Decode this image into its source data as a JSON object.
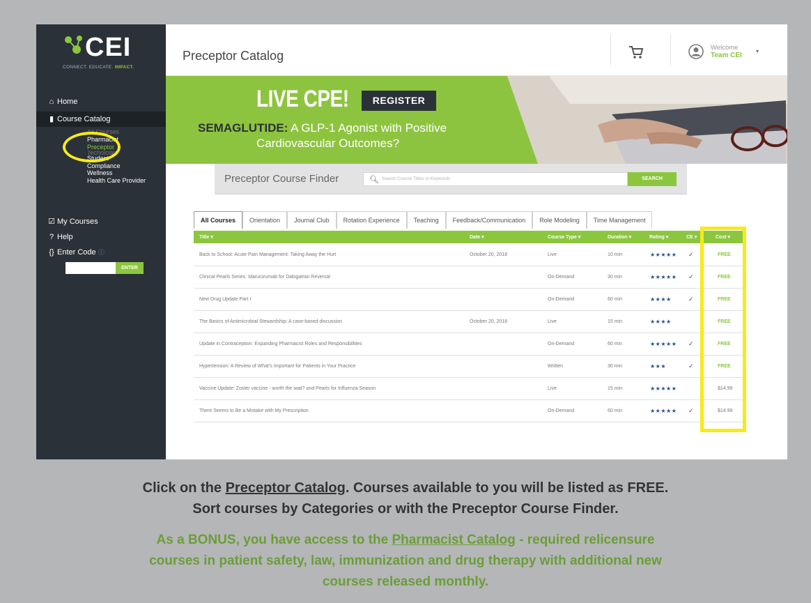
{
  "brand": {
    "logo_text": "CEI",
    "tagline_a": "CONNECT. EDUCATE.",
    "tagline_b": "IMPACT."
  },
  "colors": {
    "accent_green": "#8cc63f",
    "sidebar_dark": "#2b3138",
    "highlight_yellow": "#f6eb16",
    "star_blue": "#2a4e8c"
  },
  "header": {
    "title": "Preceptor Catalog",
    "cart_icon": "cart-icon",
    "welcome_label": "Welcome",
    "user_name": "Team CEI"
  },
  "sidebar": {
    "items": [
      {
        "icon": "home-icon",
        "glyph": "🏠",
        "label": "Home"
      },
      {
        "icon": "book-icon",
        "glyph": "▮",
        "label": "Course Catalog"
      },
      {
        "icon": "check-square-icon",
        "glyph": "☑",
        "label": "My Courses"
      },
      {
        "icon": "question-icon",
        "glyph": "❓",
        "label": "Help"
      },
      {
        "icon": "braces-icon",
        "glyph": "{ }",
        "label": "Enter Code",
        "info": "ⓘ"
      }
    ],
    "subitems": [
      {
        "label": "Pharmacist"
      },
      {
        "label": "Preceptor"
      },
      {
        "label": "Student"
      },
      {
        "label": "Compliance"
      },
      {
        "label": "Wellness"
      },
      {
        "label": "Health Care Provider"
      }
    ],
    "enter_button": "ENTER"
  },
  "banner": {
    "headline": "LIVE CPE!",
    "register_button": "REGISTER",
    "subject_bold": "SEMAGLUTIDE:",
    "subject_line1": " A GLP-1 Agonist with Positive",
    "subject_line2": "Cardiovascular Outcomes?"
  },
  "finder": {
    "label": "Preceptor Course Finder",
    "placeholder": "Search Course Titles or Keywords",
    "search_button": "SEARCH"
  },
  "tabs": [
    "All Courses",
    "Orientation",
    "Journal Club",
    "Rotation Experience",
    "Teaching",
    "Feedback/Communication",
    "Role Modeling",
    "Time Management"
  ],
  "table": {
    "columns": {
      "title": "Title ▾",
      "date": "Date ▾",
      "type": "Course Type ▾",
      "duration": "Duration ▾",
      "rating": "Rating ▾",
      "ce": "CE ▾",
      "cost": "Cost ▾"
    },
    "rows": [
      {
        "title": "Back to School: Acute Pain Management: Taking Away the Hurt",
        "date": "October 20, 2018",
        "type": "Live",
        "duration": "10 min",
        "rating": "★★★★★",
        "ce": "✓",
        "cost": "FREE"
      },
      {
        "title": "Clinical Pearls Series: Idarucizumab for Dabigatran Reversal",
        "date": "",
        "type": "On-Demand",
        "duration": "30 min",
        "rating": "★★★★★",
        "ce": "✓",
        "cost": "FREE"
      },
      {
        "title": "New Drug Update Part I",
        "date": "",
        "type": "On-Demand",
        "duration": "60 min",
        "rating": "★★★★",
        "ce": "✓",
        "cost": "FREE"
      },
      {
        "title": "The Basics of Antimicrobial Stewardship: A case-based discussion",
        "date": "October 20, 2018",
        "type": "Live",
        "duration": "15 min",
        "rating": "★★★★",
        "ce": "",
        "cost": "FREE"
      },
      {
        "title": "Update in Contraception: Expanding Pharmacist Roles and Responsibilities",
        "date": "",
        "type": "On-Demand",
        "duration": "60 min",
        "rating": "★★★★★",
        "ce": "✓",
        "cost": "FREE"
      },
      {
        "title": "Hypertension: A Review of What's Important for Patients in Your Practice",
        "date": "",
        "type": "Written",
        "duration": "30 min",
        "rating": "★★★",
        "ce": "✓",
        "cost": "FREE"
      },
      {
        "title": "Vaccine Update: Zoster vaccine - worth the wait? and Pearls for Influenza Season",
        "date": "",
        "type": "Live",
        "duration": "15 min",
        "rating": "★★★★★",
        "ce": "",
        "cost": "$14.99"
      },
      {
        "title": "There Seems to Be a Mistake with My Prescription",
        "date": "",
        "type": "On-Demand",
        "duration": "60 min",
        "rating": "★★★★★",
        "ce": "✓",
        "cost": "$14.99"
      }
    ]
  },
  "captions": {
    "line1_a": "Click on the ",
    "line1_link": "Preceptor Catalog",
    "line1_b": ". Courses available to you will be listed as FREE.",
    "line2": "Sort courses by Categories or with the Preceptor Course Finder.",
    "bonus_a": "As a BONUS, you have access to the ",
    "bonus_link": "Pharmacist Catalog",
    "bonus_b": " - required relicensure",
    "bonus_line2": "courses in patient safety, law, immunization and drug therapy with additional new",
    "bonus_line3": "courses released monthly."
  }
}
